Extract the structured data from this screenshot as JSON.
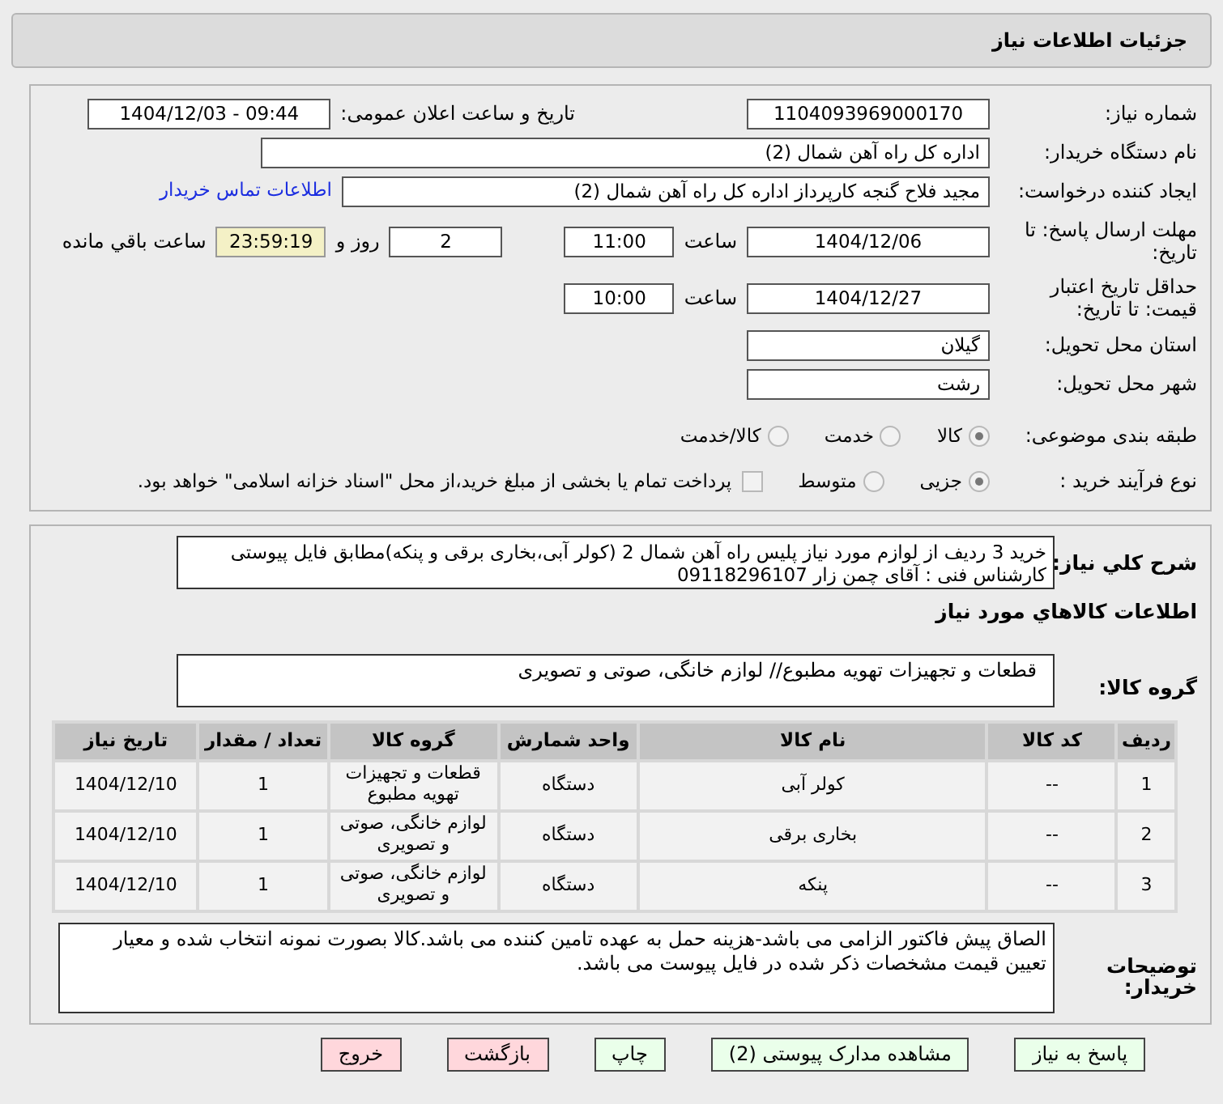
{
  "header": {
    "title": "جزئیات اطلاعات نیاز"
  },
  "need_number": {
    "label": "شماره نیاز:",
    "value": "1104093969000170"
  },
  "announce": {
    "label": "تاریخ و ساعت اعلان عمومی:",
    "value": "1404/12/03 - 09:44"
  },
  "buyer_org": {
    "label": "نام دستگاه خریدار:",
    "value": "اداره کل راه آهن شمال (2)"
  },
  "requester": {
    "label": "ایجاد کننده درخواست:",
    "value": "مجید فلاح گنجه کارپرداز اداره کل راه آهن شمال (2)",
    "link": "اطلاعات تماس خریدار"
  },
  "deadline": {
    "label": "مهلت ارسال پاسخ: تا تاریخ:",
    "date": "1404/12/06",
    "time_label": "ساعت",
    "time": "11:00",
    "days": "2",
    "days_label": "روز و",
    "remaining": "23:59:19",
    "remaining_label": "ساعت باقي مانده"
  },
  "validity": {
    "label": "حداقل تاریخ اعتبار قیمت: تا تاریخ:",
    "date": "1404/12/27",
    "time_label": "ساعت",
    "time": "10:00"
  },
  "province": {
    "label": "استان محل تحویل:",
    "value": "گیلان"
  },
  "city": {
    "label": "شهر محل تحویل:",
    "value": "رشت"
  },
  "category": {
    "label": "طبقه بندی موضوعی:",
    "options": [
      {
        "label": "کالا",
        "selected": true
      },
      {
        "label": "خدمت",
        "selected": false
      },
      {
        "label": "کالا/خدمت",
        "selected": false
      }
    ]
  },
  "process": {
    "label": "نوع فرآیند خرید :",
    "options": [
      {
        "label": "جزیی",
        "selected": true
      },
      {
        "label": "متوسط",
        "selected": false
      }
    ],
    "checkbox": {
      "checked": false,
      "label": "پرداخت تمام یا بخشی از مبلغ خرید،از محل \"اسناد خزانه اسلامی\" خواهد بود."
    }
  },
  "description": {
    "label": "شرح کلي نیاز:",
    "value": "خرید 3 ردیف از لوازم مورد نیاز پلیس راه آهن شمال 2 (کولر آبی،بخاری برقی و پنکه)مطابق فایل پیوستی کارشناس فنی : آقای چمن زار 09118296107"
  },
  "goods_title": "اطلاعات کالاهاي مورد نیاز",
  "goods_group": {
    "label": "گروه کالا:",
    "value": "قطعات و تجهیزات تهویه مطبوع// لوازم خانگی، صوتی و تصویری"
  },
  "table": {
    "columns": [
      "ردیف",
      "کد کالا",
      "نام کالا",
      "واحد شمارش",
      "گروه کالا",
      "تعداد / مقدار",
      "تاریخ نیاز"
    ],
    "rows": [
      [
        "1",
        "--",
        "کولر آبی",
        "دستگاه",
        "قطعات و تجهیزات تهویه مطبوع",
        "1",
        "1404/12/10"
      ],
      [
        "2",
        "--",
        "بخاری برقی",
        "دستگاه",
        "لوازم خانگی، صوتی و تصویری",
        "1",
        "1404/12/10"
      ],
      [
        "3",
        "--",
        "پنکه",
        "دستگاه",
        "لوازم خانگی، صوتی و تصویری",
        "1",
        "1404/12/10"
      ]
    ]
  },
  "buyer_notes": {
    "label": "توضیحات خریدار:",
    "value": "الصاق پیش فاکتور الزامی می باشد-هزینه حمل به عهده تامین کننده می باشد.کالا بصورت نمونه انتخاب شده و معیار تعیین قیمت مشخصات ذکر شده در فایل پیوست می باشد."
  },
  "buttons": [
    {
      "label": "پاسخ به نیاز",
      "kind": "normal"
    },
    {
      "label": "مشاهده مدارک پیوستی (2)",
      "kind": "normal"
    },
    {
      "label": "چاپ",
      "kind": "normal"
    },
    {
      "label": "بازگشت",
      "kind": "danger"
    },
    {
      "label": "خروج",
      "kind": "danger"
    }
  ]
}
